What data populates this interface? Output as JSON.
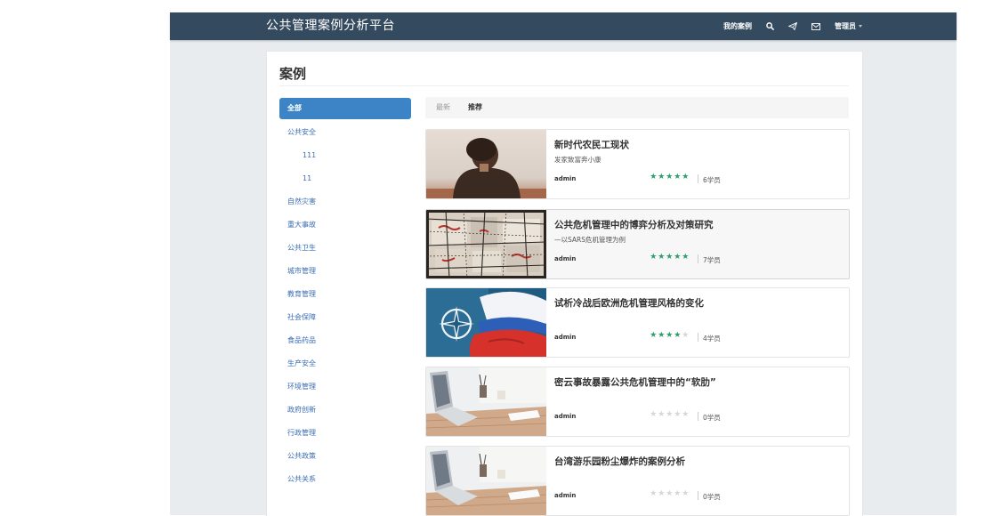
{
  "header": {
    "brand": "公共管理案例分析平台",
    "my_cases": "我的案例",
    "admin": "管理员"
  },
  "page": {
    "title": "案例"
  },
  "sidebar": {
    "items": [
      {
        "label": "全部"
      },
      {
        "label": "公共安全"
      },
      {
        "label": "111"
      },
      {
        "label": "11"
      },
      {
        "label": "自然灾害"
      },
      {
        "label": "重大事故"
      },
      {
        "label": "公共卫生"
      },
      {
        "label": "城市管理"
      },
      {
        "label": "教育管理"
      },
      {
        "label": "社会保障"
      },
      {
        "label": "食品药品"
      },
      {
        "label": "生产安全"
      },
      {
        "label": "环境管理"
      },
      {
        "label": "政府创新"
      },
      {
        "label": "行政管理"
      },
      {
        "label": "公共政策"
      },
      {
        "label": "公共关系"
      }
    ]
  },
  "tabs": {
    "latest": "最新",
    "recommended": "推荐"
  },
  "cases": [
    {
      "title": "新时代农民工现状",
      "subtitle": "发家致富奔小康",
      "author": "admin",
      "rating": 5,
      "students": "6学员"
    },
    {
      "title": "公共危机管理中的博弈分析及对策研究",
      "subtitle": "—以SARS危机管理为例",
      "author": "admin",
      "rating": 5,
      "students": "7学员"
    },
    {
      "title": "试析冷战后欧洲危机管理风格的变化",
      "subtitle": "",
      "author": "admin",
      "rating": 4,
      "students": "4学员"
    },
    {
      "title": "密云事故暴露公共危机管理中的“软肋”",
      "subtitle": "",
      "author": "admin",
      "rating": 0,
      "students": "0学员"
    },
    {
      "title": "台湾游乐园粉尘爆炸的案例分析",
      "subtitle": "",
      "author": "admin",
      "rating": 0,
      "students": "0学员"
    }
  ],
  "colors": {
    "navbar": "#344a5f",
    "sidebar_active": "#3d84c6",
    "link": "#3c6eb4",
    "star_on": "#2d9e6b"
  },
  "icons": [
    "search-icon",
    "paper-plane-icon",
    "envelope-icon",
    "caret-down-icon",
    "star-icon"
  ]
}
